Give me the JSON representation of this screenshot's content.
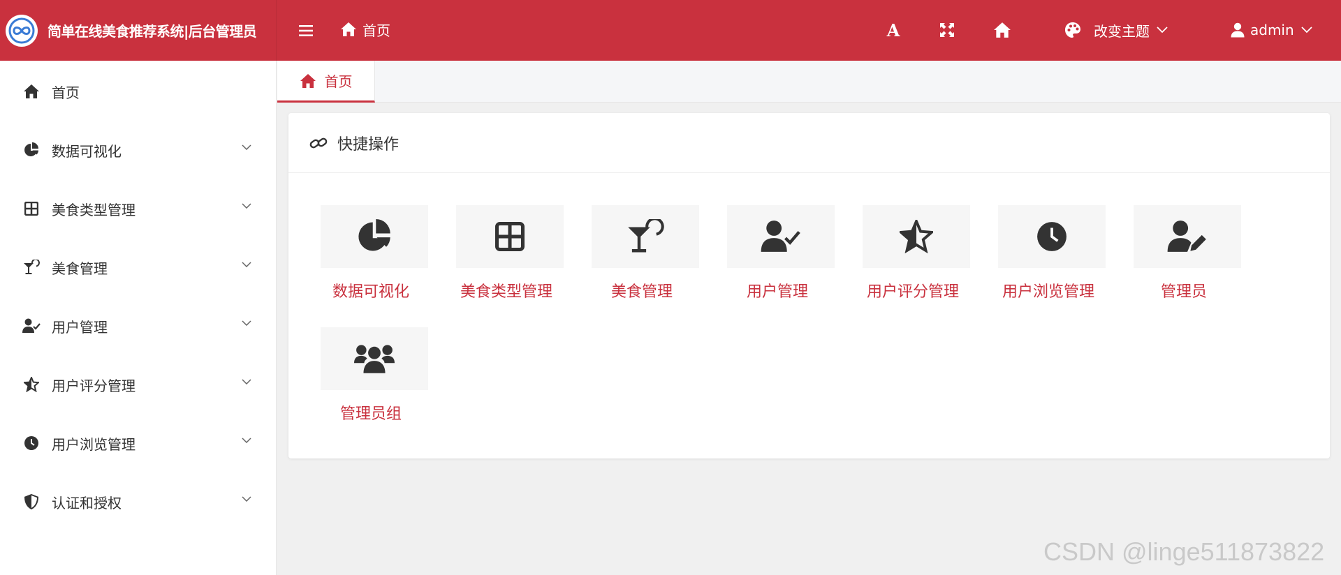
{
  "header": {
    "app_title": "简单在线美食推荐系统|后台管理员",
    "breadcrumb": "首页",
    "font_icon_letter": "A",
    "theme_label": "改变主题",
    "user_name": "admin",
    "icons": [
      "menu-icon",
      "home-icon",
      "font-size-icon",
      "fullscreen-icon",
      "home-icon",
      "palette-icon",
      "chevron-down-icon",
      "user-icon",
      "chevron-down-icon"
    ]
  },
  "sidebar": {
    "items": [
      {
        "label": "首页",
        "icon": "home-icon"
      },
      {
        "label": "数据可视化",
        "icon": "chart-pie-icon"
      },
      {
        "label": "美食类型管理",
        "icon": "grid-icon"
      },
      {
        "label": "美食管理",
        "icon": "cocktail-icon"
      },
      {
        "label": "用户管理",
        "icon": "user-check-icon"
      },
      {
        "label": "用户评分管理",
        "icon": "star-half-icon"
      },
      {
        "label": "用户浏览管理",
        "icon": "clock-icon"
      },
      {
        "label": "认证和授权",
        "icon": "shield-icon"
      }
    ]
  },
  "tabs": [
    {
      "label": "首页",
      "icon": "home-icon"
    }
  ],
  "card": {
    "title": "快捷操作",
    "actions": [
      {
        "label": "数据可视化",
        "icon": "chart-pie-icon"
      },
      {
        "label": "美食类型管理",
        "icon": "grid-icon"
      },
      {
        "label": "美食管理",
        "icon": "cocktail-icon"
      },
      {
        "label": "用户管理",
        "icon": "user-check-icon"
      },
      {
        "label": "用户评分管理",
        "icon": "star-half-icon"
      },
      {
        "label": "用户浏览管理",
        "icon": "clock-icon"
      },
      {
        "label": "管理员",
        "icon": "user-edit-icon"
      },
      {
        "label": "管理员组",
        "icon": "users-icon"
      }
    ]
  },
  "watermark": "CSDN @linge511873822",
  "colors": {
    "primary": "#c9313e",
    "sidebar_bg": "#ffffff",
    "content_bg": "#f0f0f0",
    "icon_dark": "#333333"
  }
}
